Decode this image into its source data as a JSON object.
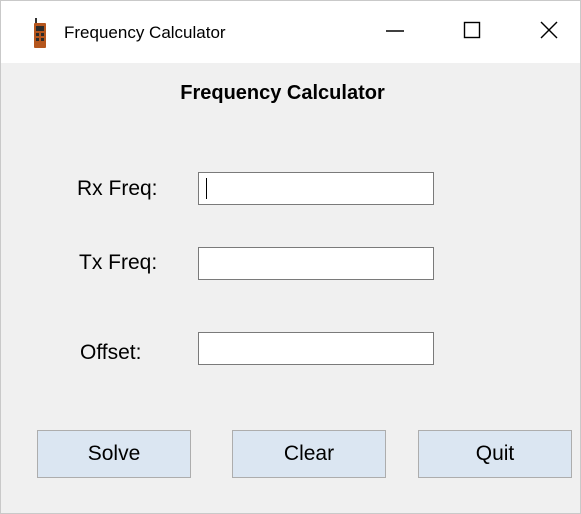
{
  "window": {
    "title": "Frequency Calculator",
    "controls": {
      "minimize_icon": "minimize-icon",
      "maximize_icon": "maximize-icon",
      "close_icon": "close-icon"
    },
    "app_icon": "radio-icon"
  },
  "form": {
    "heading": "Frequency Calculator",
    "rx_label": "Rx Freq:",
    "rx_value": "",
    "tx_label": "Tx Freq:",
    "tx_value": "",
    "offset_label": "Offset:",
    "offset_value": ""
  },
  "buttons": {
    "solve": "Solve",
    "clear": "Clear",
    "quit": "Quit"
  },
  "colors": {
    "button_bg": "#dbe6f2",
    "window_bg": "#f0f0f0",
    "icon_brand": "#b5561d"
  }
}
